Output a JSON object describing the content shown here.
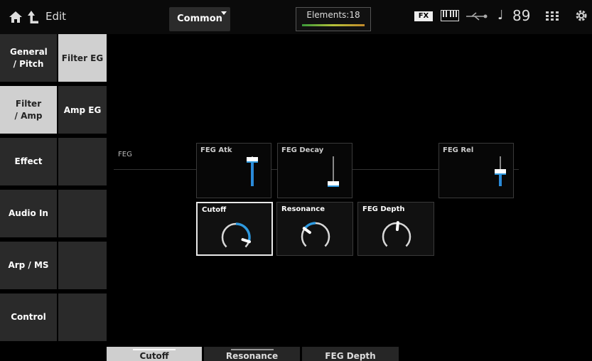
{
  "header": {
    "edit_label": "Edit",
    "common_label": "Common",
    "elements_label": "Elements:18",
    "fx_badge": "FX",
    "tempo_symbol": "♩",
    "tempo": "89"
  },
  "sidebar": {
    "items": [
      {
        "label": "General / Pitch",
        "active": false
      },
      {
        "label": "Filter / Amp",
        "active": true
      },
      {
        "label": "Effect",
        "active": false
      },
      {
        "label": "Audio In",
        "active": false
      },
      {
        "label": "Arp / MS",
        "active": false
      },
      {
        "label": "Control",
        "active": false
      }
    ]
  },
  "subtabs": {
    "items": [
      {
        "label": "Filter EG",
        "active": true
      },
      {
        "label": "Amp EG",
        "active": false
      }
    ]
  },
  "main": {
    "feg_label": "FEG",
    "sliders": [
      {
        "label": "FEG Atk",
        "level": 0.9
      },
      {
        "label": "FEG Decay",
        "level": 0.1
      },
      {
        "label": "FEG Rel",
        "level": 0.5
      }
    ],
    "knobs": [
      {
        "label": "Cutoff",
        "value_fraction": 0.9,
        "selected": true
      },
      {
        "label": "Resonance",
        "value_fraction": 0.3,
        "selected": false
      },
      {
        "label": "FEG Depth",
        "value_fraction": 0.52,
        "selected": false
      }
    ]
  },
  "bottom_tabs": [
    {
      "label": "Cutoff",
      "active": true
    },
    {
      "label": "Resonance",
      "active": false
    },
    {
      "label": "FEG Depth",
      "active": false
    }
  ],
  "colors": {
    "accent": "#2e9ae0",
    "selected_bg": "#d0d0d0",
    "button_bg": "#2a2a2a"
  }
}
